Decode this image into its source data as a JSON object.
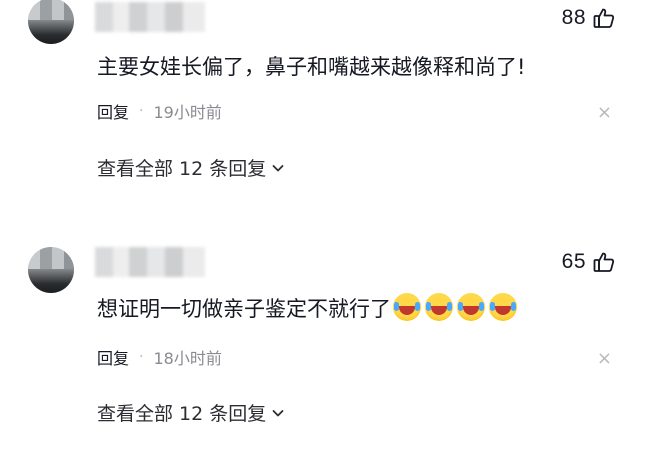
{
  "comments": [
    {
      "likes": "88",
      "text": "主要女娃长偏了，鼻子和嘴越来越像释和尚了!",
      "reply_label": "回复",
      "separator": "·",
      "time": "19小时前",
      "close_glyph": "×",
      "view_replies": "查看全部 12 条回复"
    },
    {
      "likes": "65",
      "text": "想证明一切做亲子鉴定不就行了",
      "emojis": [
        "laughing-crying-emoji",
        "laughing-crying-emoji",
        "laughing-crying-emoji",
        "laughing-crying-emoji"
      ],
      "reply_label": "回复",
      "separator": "·",
      "time": "18小时前",
      "close_glyph": "×",
      "view_replies": "查看全部 12 条回复"
    }
  ],
  "icons": {
    "like": "thumbs-up-icon",
    "expand": "chevron-down-icon",
    "close": "close-icon"
  }
}
